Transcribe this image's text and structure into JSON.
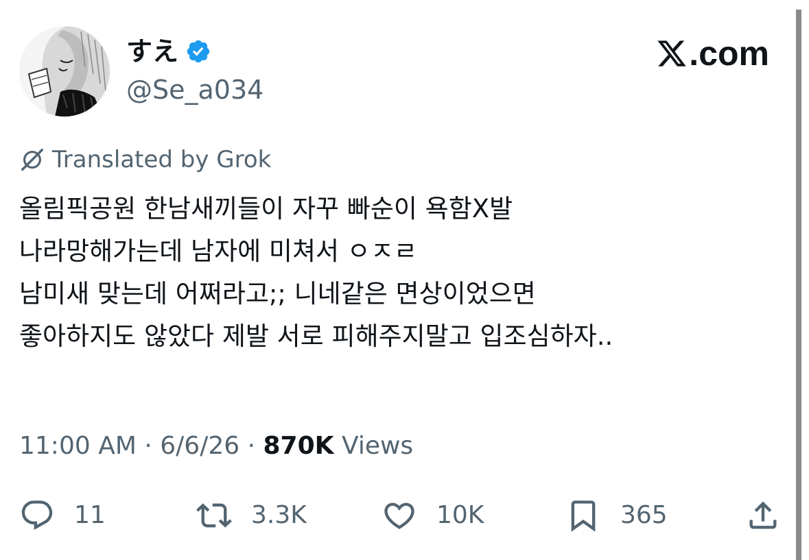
{
  "author": {
    "display_name": "すえ",
    "handle": "@Se_a034",
    "verified": true
  },
  "brand": {
    "label": ".com",
    "logo_icon": "x-logo-icon"
  },
  "translation": {
    "label": "Translated by Grok",
    "icon": "grok-icon"
  },
  "tweet": {
    "lines": [
      "올림픽공원 한남새끼들이 자꾸 빠순이 욕함X발",
      "나라망해가는데 남자에 미쳐서 ㅇㅈㄹ",
      "남미새 맞는데 어쩌라고;; 니네같은 면상이었으면",
      "좋아하지도 않았다 제발 서로 피해주지말고 입조심하자.."
    ]
  },
  "meta": {
    "time": "11:00 AM",
    "separator": "·",
    "date": "6/6/26",
    "views_count": "870K",
    "views_label": "Views"
  },
  "actions": {
    "replies": "11",
    "reposts": "3.3K",
    "likes": "10K",
    "bookmarks": "365"
  },
  "colors": {
    "text_primary": "#0f1419",
    "text_secondary": "#536471",
    "verified_blue": "#1d9bf0",
    "background": "#ffffff"
  }
}
